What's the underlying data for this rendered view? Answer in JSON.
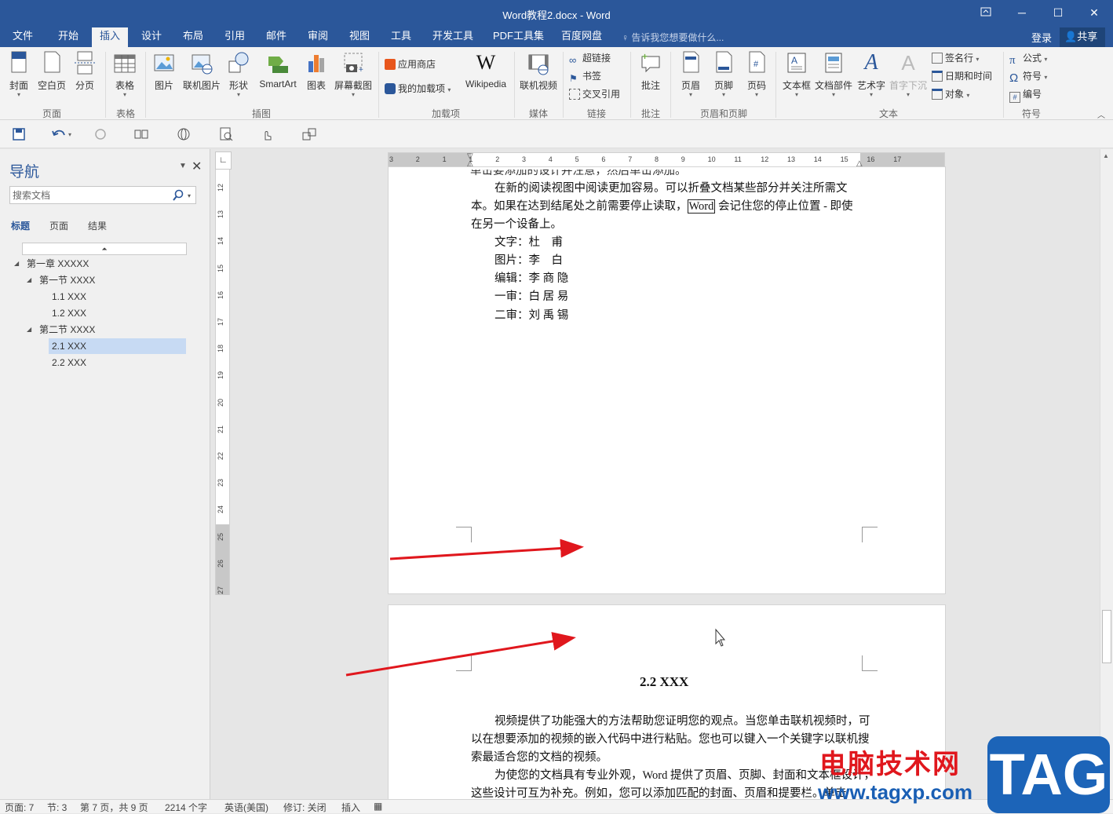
{
  "window": {
    "title": "Word教程2.docx - Word"
  },
  "tabs": [
    {
      "label": "文件"
    },
    {
      "label": "开始"
    },
    {
      "label": "插入"
    },
    {
      "label": "设计"
    },
    {
      "label": "布局"
    },
    {
      "label": "引用"
    },
    {
      "label": "邮件"
    },
    {
      "label": "审阅"
    },
    {
      "label": "视图"
    },
    {
      "label": "工具"
    },
    {
      "label": "开发工具"
    },
    {
      "label": "PDF工具集"
    },
    {
      "label": "百度网盘"
    }
  ],
  "active_tab": "插入",
  "tell_me": "告诉我您想要做什么...",
  "login": "登录",
  "share": "共享",
  "ribbon": {
    "pages": {
      "cover": "封面",
      "blank": "空白页",
      "break": "分页",
      "group": "页面"
    },
    "tables": {
      "table": "表格",
      "group": "表格"
    },
    "illustrations": {
      "picture": "图片",
      "online_picture": "联机图片",
      "shapes": "形状",
      "smartart": "SmartArt",
      "chart": "图表",
      "screenshot": "屏幕截图",
      "group": "插图"
    },
    "addins": {
      "store": "应用商店",
      "my_addins": "我的加载项",
      "wikipedia": "Wikipedia",
      "group": "加载项"
    },
    "media": {
      "online_video": "联机视频",
      "group": "媒体"
    },
    "links": {
      "hyperlink": "超链接",
      "bookmark": "书签",
      "cross_ref": "交叉引用",
      "group": "链接"
    },
    "comments": {
      "comment": "批注",
      "group": "批注"
    },
    "header_footer": {
      "header": "页眉",
      "footer": "页脚",
      "page_number": "页码",
      "group": "页眉和页脚"
    },
    "text": {
      "textbox": "文本框",
      "quick_parts": "文档部件",
      "wordart": "艺术字",
      "dropcap": "首字下沉",
      "signature": "签名行",
      "datetime": "日期和时间",
      "object": "对象",
      "group": "文本"
    },
    "symbols": {
      "equation": "公式",
      "symbol": "符号",
      "number": "编号",
      "group": "符号"
    }
  },
  "nav": {
    "title": "导航",
    "search_placeholder": "搜索文档",
    "tabs": [
      "标题",
      "页面",
      "结果"
    ],
    "tree": [
      {
        "label": "第一章 XXXXX"
      },
      {
        "label": "第一节 XXXX"
      },
      {
        "label": "1.1 XXX"
      },
      {
        "label": "1.2 XXX"
      },
      {
        "label": "第二节 XXXX"
      },
      {
        "label": "2.1 XXX"
      },
      {
        "label": "2.2 XXX"
      }
    ]
  },
  "ruler": {
    "h_ticks": [
      "3",
      "2",
      "1",
      "1",
      "2",
      "3",
      "4",
      "5",
      "6",
      "7",
      "8",
      "9",
      "10",
      "11",
      "12",
      "13",
      "14",
      "15",
      "16",
      "17"
    ],
    "v_ticks": [
      "12",
      "13",
      "14",
      "15",
      "16",
      "17",
      "18",
      "19",
      "20",
      "21",
      "22",
      "23",
      "24",
      "25",
      "26",
      "27"
    ]
  },
  "page1": {
    "para1_line1": "在新的阅读视图中阅读更加容易。可以折叠文档某些部分并关注所需文",
    "para1_line2_a": "本。如果在达到结尾处之前需要停止读取，",
    "para1_line2_word": "Word",
    "para1_line2_b": " 会记住您的停止位置 - 即使",
    "para1_line3": "在另一个设备上。",
    "credits": [
      {
        "label": "文字：",
        "name": "杜　甫"
      },
      {
        "label": "图片：",
        "name": "李　白"
      },
      {
        "label": "编辑：",
        "name": "李 商 隐"
      },
      {
        "label": "一审：",
        "name": "白 居 易"
      },
      {
        "label": "二审：",
        "name": "刘 禹 锡"
      }
    ]
  },
  "page2": {
    "heading": "2.2 XXX",
    "p1_l1": "视频提供了功能强大的方法帮助您证明您的观点。当您单击联机视频时，可",
    "p1_l2": "以在想要添加的视频的嵌入代码中进行粘贴。您也可以键入一个关键字以联机搜",
    "p1_l3": "索最适合您的文档的视频。",
    "p2_l1": "为使您的文档具有专业外观，Word 提供了页眉、页脚、封面和文本框设计，",
    "p2_l2": "这些设计可互为补充。例如，您可以添加匹配的封面、页眉和提要栏。单击"
  },
  "status": {
    "page": "页面: 7",
    "section": "节: 3",
    "page_of": "第 7 页，共 9 页",
    "words": "2214 个字",
    "language": "英语(美国)",
    "track": "修订: 关闭",
    "mode": "插入"
  },
  "watermark": {
    "site_name": "电脑技术网",
    "url": "www.tagxp.com",
    "logo": "TAG"
  },
  "colors": {
    "brand": "#2b579a",
    "arrow": "#e0171d"
  }
}
